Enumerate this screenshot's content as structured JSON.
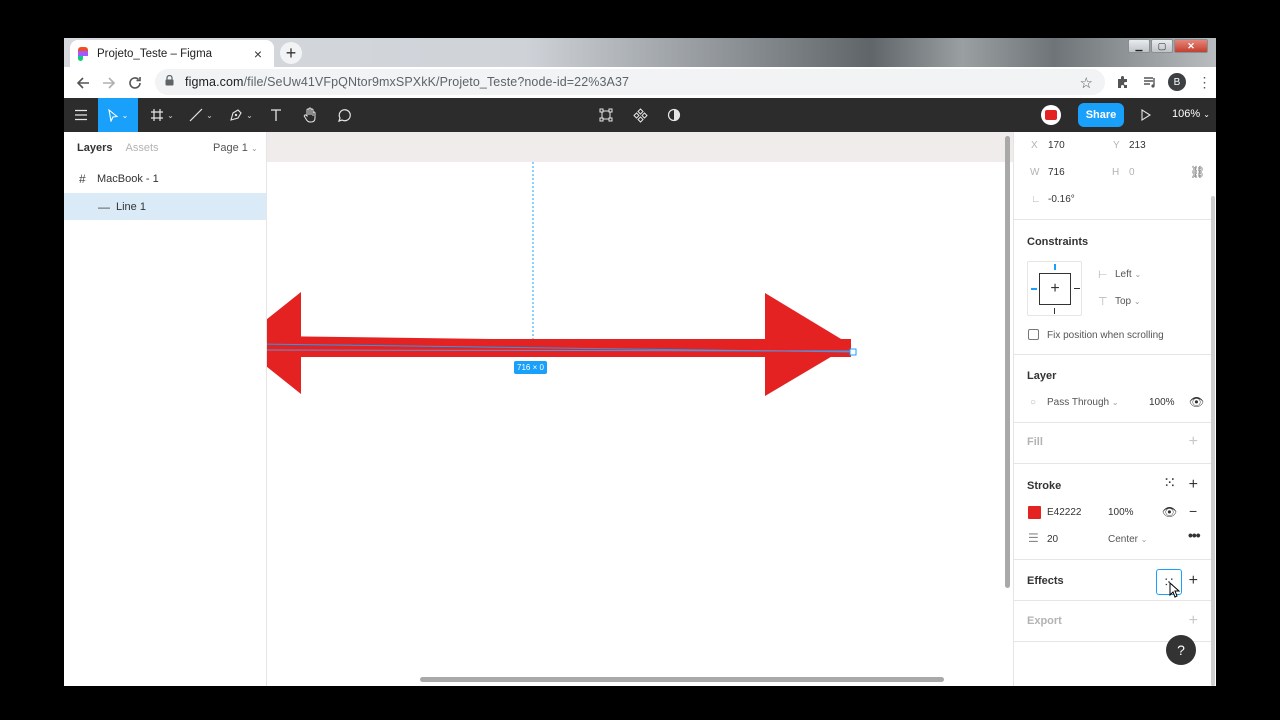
{
  "browser": {
    "tab_title": "Projeto_Teste – Figma",
    "tab_close": "×",
    "new_tab": "+",
    "url_host": "figma.com",
    "url_path": "/file/SeUw41VFpQNtor9mxSPXkK/Projeto_Teste?node-id=22%3A37",
    "avatar_letter": "B",
    "window_close": "✕"
  },
  "figma_toolbar": {
    "share_label": "Share",
    "zoom_label": "106%"
  },
  "layers_panel": {
    "tab_layers": "Layers",
    "tab_assets": "Assets",
    "page_selector": "Page 1",
    "frame_name": "MacBook - 1",
    "line_name": "Line 1"
  },
  "canvas": {
    "dimension_badge": "716 × 0"
  },
  "design_panel": {
    "x_label": "X",
    "x_value": "170",
    "y_label": "Y",
    "y_value": "213",
    "w_label": "W",
    "w_value": "716",
    "h_label": "H",
    "h_value": "0",
    "rotation_value": "-0.16°",
    "constraints_title": "Constraints",
    "constraint_h": "Left",
    "constraint_v": "Top",
    "fix_position_label": "Fix position when scrolling",
    "layer_title": "Layer",
    "blend_mode": "Pass Through",
    "layer_opacity": "100%",
    "fill_title": "Fill",
    "stroke_title": "Stroke",
    "stroke_hex": "E42222",
    "stroke_opacity": "100%",
    "stroke_weight": "20",
    "stroke_align": "Center",
    "effects_title": "Effects",
    "export_title": "Export",
    "help_label": "?"
  },
  "colors": {
    "stroke": "#e42222",
    "accent": "#18a0fb",
    "toolbar_bg": "#2c2c2c"
  }
}
